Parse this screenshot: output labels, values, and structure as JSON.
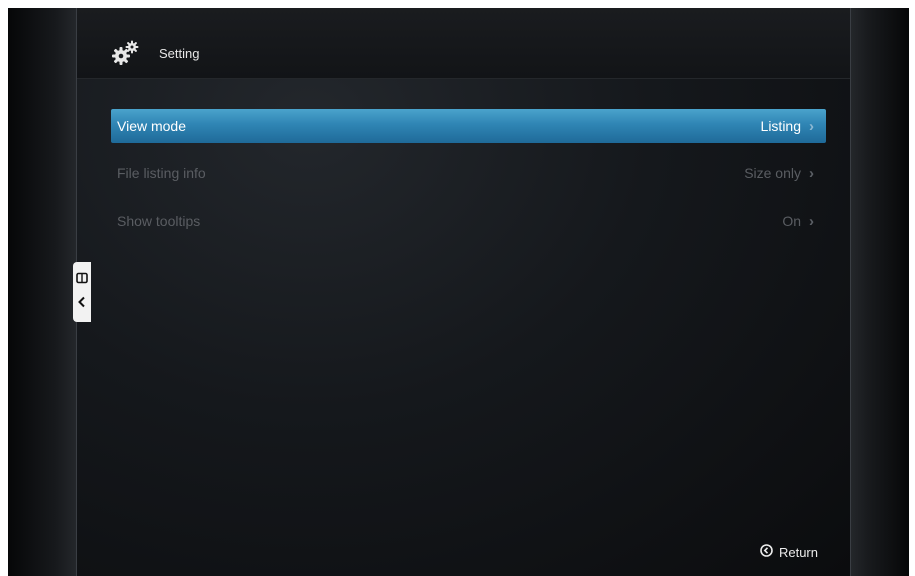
{
  "header": {
    "title": "Setting",
    "icon": "gear-icon"
  },
  "menu": {
    "items": [
      {
        "label": "View mode",
        "value": "Listing",
        "selected": true
      },
      {
        "label": "File listing info",
        "value": "Size only",
        "selected": false
      },
      {
        "label": "Show tooltips",
        "value": "On",
        "selected": false
      }
    ],
    "chevron_glyph": "›"
  },
  "side_tab": {
    "icon_top": "panel-icon",
    "icon_bottom": "chevron-left-icon"
  },
  "footer": {
    "return_label": "Return",
    "return_icon": "back-circle-icon"
  },
  "colors": {
    "selection": "#2f85b4",
    "text_dim": "#5a5d62",
    "text_bright": "#ffffff"
  }
}
